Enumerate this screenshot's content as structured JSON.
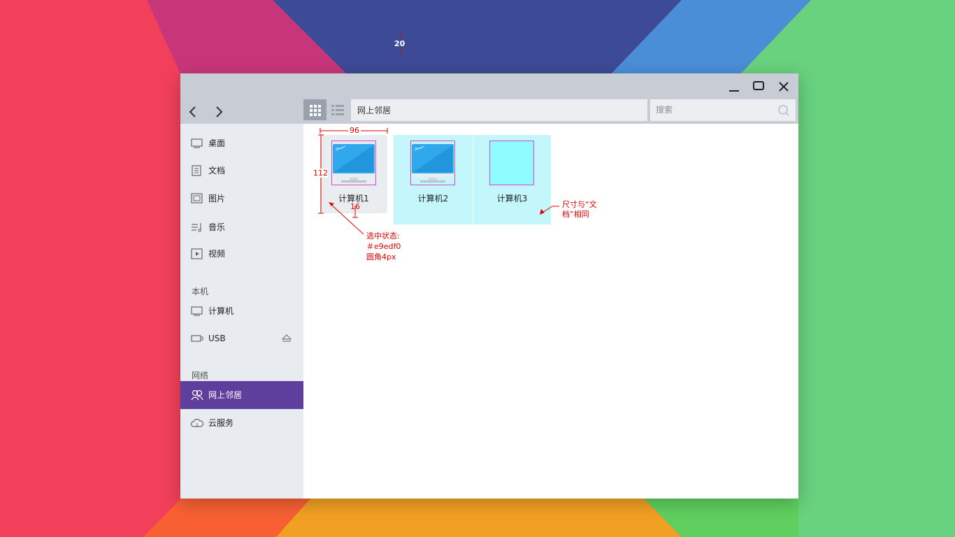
{
  "window": {
    "minimize_label": "minimize",
    "maximize_label": "maximize",
    "close_label": "close"
  },
  "toolbar": {
    "path": "网上邻居",
    "search_placeholder": "搜索"
  },
  "sidebar": {
    "favorites": [
      {
        "label": "桌面",
        "icon": "desktop-icon"
      },
      {
        "label": "文档",
        "icon": "document-icon"
      },
      {
        "label": "图片",
        "icon": "picture-icon"
      },
      {
        "label": "音乐",
        "icon": "music-icon"
      },
      {
        "label": "视频",
        "icon": "video-icon"
      }
    ],
    "local_header": "本机",
    "local": [
      {
        "label": "计算机",
        "icon": "computer-icon"
      },
      {
        "label": "USB",
        "icon": "usb-icon"
      }
    ],
    "network_header": "网络",
    "network": [
      {
        "label": "网上邻居",
        "icon": "network-neighbors-icon",
        "active": true
      },
      {
        "label": "云服务",
        "icon": "cloud-icon"
      }
    ]
  },
  "files": [
    {
      "name": "计算机1",
      "state": "selected"
    },
    {
      "name": "计算机2",
      "state": "hover"
    },
    {
      "name": "计算机3",
      "state": "hover"
    }
  ],
  "annotations": {
    "gap_top": "20",
    "width": "96",
    "height": "112",
    "spacing": "16",
    "selected_line1": "选中状态:",
    "selected_line2": "＃e9edf0",
    "selected_line3": "圆角4px",
    "size_note_line1": "尺寸与“文",
    "size_note_line2": "档”相同"
  },
  "colors": {
    "accent": "#5f3f9e",
    "selected_bg": "#e9edf0",
    "hover_bg": "#c3f7fb"
  }
}
